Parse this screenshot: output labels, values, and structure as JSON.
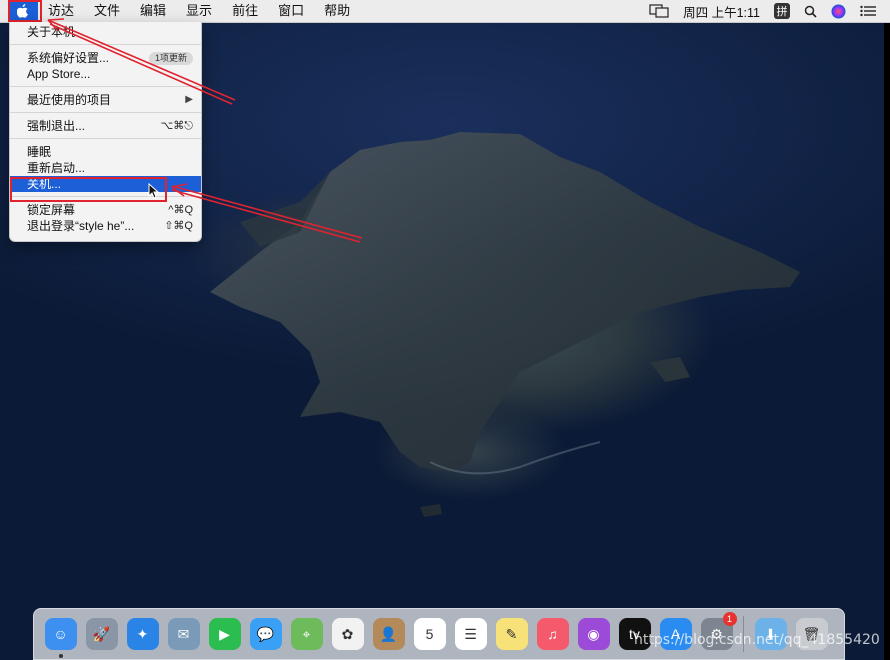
{
  "menubar": {
    "apple_icon": "apple-logo-icon",
    "items": [
      "访达",
      "文件",
      "编辑",
      "显示",
      "前往",
      "窗口",
      "帮助"
    ],
    "clock": "周四 上午1:11",
    "input_method": "拼",
    "status_icons": [
      "display-mirror-icon",
      "search-icon",
      "siri-icon",
      "control-list-icon"
    ]
  },
  "apple_menu": {
    "about": "关于本机",
    "system_prefs": "系统偏好设置...",
    "system_prefs_badge": "1项更新",
    "app_store": "App Store...",
    "recent_items": "最近使用的项目",
    "force_quit": "强制退出...",
    "force_quit_shortcut": "⌥⌘⎋",
    "sleep": "睡眠",
    "restart": "重新启动...",
    "shutdown": "关机...",
    "lock_screen": "锁定屏幕",
    "lock_shortcut": "^⌘Q",
    "logout": "退出登录“style he”...",
    "logout_shortcut": "⇧⌘Q"
  },
  "dock": {
    "apps": [
      {
        "name": "finder-icon",
        "color": "#3d8ff0",
        "glyph": "☺"
      },
      {
        "name": "launchpad-icon",
        "color": "#8a96a6",
        "glyph": "🚀"
      },
      {
        "name": "safari-icon",
        "color": "#2a84e6",
        "glyph": "✦"
      },
      {
        "name": "mail-icon",
        "color": "#7a9ab8",
        "glyph": "✉"
      },
      {
        "name": "facetime-icon",
        "color": "#2bbd4f",
        "glyph": "▶"
      },
      {
        "name": "messages-icon",
        "color": "#3aa0f5",
        "glyph": "💬"
      },
      {
        "name": "maps-icon",
        "color": "#6dbb5b",
        "glyph": "⌖"
      },
      {
        "name": "photos-icon",
        "color": "#f2f2f2",
        "glyph": "✿"
      },
      {
        "name": "contacts-icon",
        "color": "#b58a5a",
        "glyph": "👤"
      },
      {
        "name": "calendar-icon",
        "color": "#ffffff",
        "glyph": "5"
      },
      {
        "name": "reminders-icon",
        "color": "#ffffff",
        "glyph": "☰"
      },
      {
        "name": "notes-icon",
        "color": "#f7e27a",
        "glyph": "✎"
      },
      {
        "name": "music-icon",
        "color": "#f45a6c",
        "glyph": "♫"
      },
      {
        "name": "podcasts-icon",
        "color": "#9b4bd8",
        "glyph": "◉"
      },
      {
        "name": "apple-tv-icon",
        "color": "#111111",
        "glyph": "tv"
      },
      {
        "name": "app-store-icon",
        "color": "#2a8cf0",
        "glyph": "A"
      },
      {
        "name": "system-preferences-icon",
        "color": "#7d8590",
        "glyph": "⚙",
        "badge": "1"
      }
    ],
    "folder": {
      "name": "downloads-folder-icon",
      "color": "#6cb1e8",
      "glyph": "⬇"
    },
    "trash": {
      "name": "trash-icon",
      "color": "#c8ccd0",
      "glyph": "🗑"
    }
  },
  "watermark": "https://blog.csdn.net/qq_41855420"
}
